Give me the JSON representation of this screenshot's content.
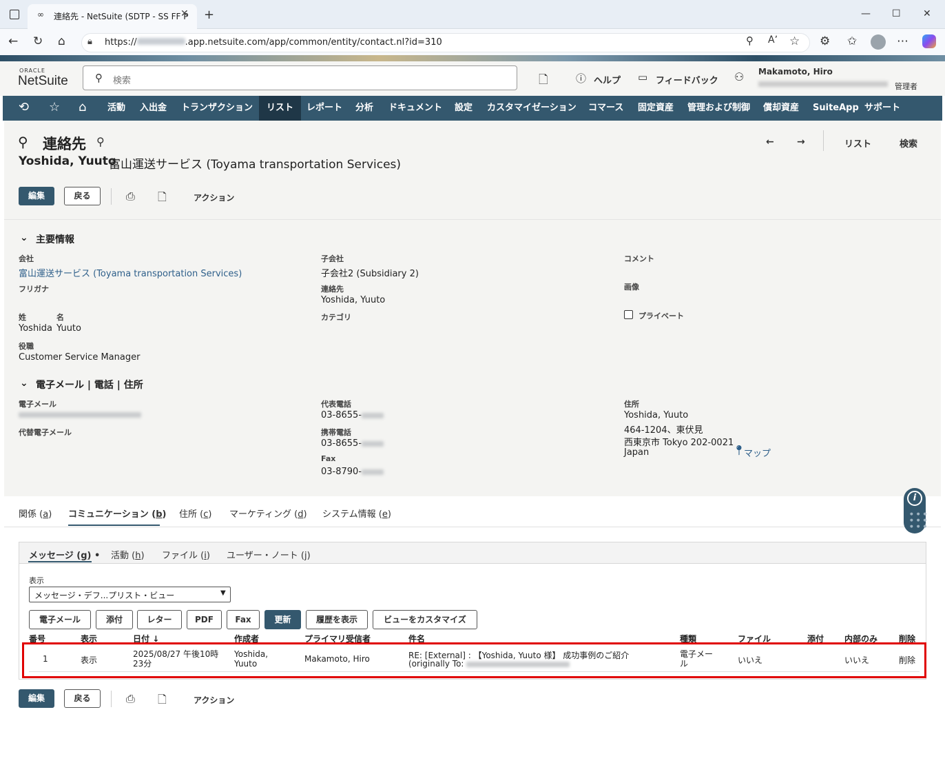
{
  "browser": {
    "tab_title": "連絡先 - NetSuite (SDTP - SS FF P",
    "url_prefix": "https://",
    "url_rest": ".app.netsuite.com/app/common/entity/contact.nl?id=310",
    "icons": [
      "back-icon",
      "reload-icon",
      "home-icon",
      "lock-icon",
      "zoom-icon",
      "read-aloud-icon",
      "favorite-icon",
      "extensions-icon",
      "favorites-icon",
      "profile-icon",
      "more-icon",
      "copilot-icon"
    ]
  },
  "header": {
    "logo_top": "ORACLE",
    "logo": "NetSuite",
    "search_placeholder": "検索",
    "help": "ヘルプ",
    "feedback": "フィードバック",
    "user_name": "Makamoto, Hiro",
    "user_role": "管理者"
  },
  "nav": {
    "items": [
      "活動",
      "入出金",
      "トランザクション",
      "リスト",
      "レポート",
      "分析",
      "ドキュメント",
      "設定",
      "カスタマイゼーション",
      "コマース",
      "固定資産",
      "管理および制御",
      "償却資産",
      "SuiteApp",
      "サポート"
    ],
    "active": "リスト"
  },
  "record": {
    "type": "連絡先",
    "name": "Yoshida, Yuuto",
    "company": "富山運送サービス (Toyama transportation Services)",
    "nav_list": "リスト",
    "nav_search": "検索"
  },
  "buttons": {
    "edit": "編集",
    "back": "戻る",
    "action": "アクション"
  },
  "primary": {
    "section_title": "主要情報",
    "company_label": "会社",
    "company_value": "富山運送サービス (Toyama transportation Services)",
    "furigana_label": "フリガナ",
    "last_label": "姓",
    "last_value": "Yoshida",
    "first_label": "名",
    "first_value": "Yuuto",
    "title_label": "役職",
    "title_value": "Customer Service Manager",
    "subsidiary_label": "子会社",
    "subsidiary_value": "子会社2 (Subsidiary 2)",
    "contact_label": "連絡先",
    "contact_value": "Yoshida, Yuuto",
    "category_label": "カテゴリ",
    "comment_label": "コメント",
    "image_label": "画像",
    "private_label": "プライベート"
  },
  "contact_info": {
    "section_title": "電子メール | 電話 | 住所",
    "email_label": "電子メール",
    "alt_email_label": "代替電子メール",
    "phone_label": "代表電話",
    "phone_value": "03-8655-",
    "mobile_label": "携帯電話",
    "mobile_value": "03-8655-",
    "fax_label": "Fax",
    "fax_value": "03-8790-",
    "address_label": "住所",
    "address_lines": [
      "Yoshida, Yuuto",
      "464-1204、東伏見",
      "西東京市 Tokyo 202-0021",
      "Japan"
    ],
    "map": "マップ"
  },
  "subtabs": [
    {
      "label": "関係",
      "key": "a"
    },
    {
      "label": "コミュニケーション",
      "key": "b"
    },
    {
      "label": "住所",
      "key": "c"
    },
    {
      "label": "マーケティング",
      "key": "d"
    },
    {
      "label": "システム情報",
      "key": "e"
    }
  ],
  "inner_tabs": [
    {
      "label": "メッセージ",
      "key": "g"
    },
    {
      "label": "活動",
      "key": "h"
    },
    {
      "label": "ファイル",
      "key": "i"
    },
    {
      "label": "ユーザー・ノート",
      "key": "j"
    }
  ],
  "messages": {
    "view_label": "表示",
    "view_value": "メッセージ・デフ...プリスト・ビュー",
    "buttons": [
      "電子メール",
      "添付",
      "レター",
      "PDF",
      "Fax",
      "更新",
      "履歴を表示",
      "ビューをカスタマイズ"
    ],
    "columns": [
      "番号",
      "表示",
      "日付",
      "作成者",
      "プライマリ受信者",
      "件名",
      "種類",
      "ファイル",
      "添付",
      "内部のみ",
      "削除"
    ],
    "row": {
      "num": "1",
      "view": "表示",
      "date": "2025/08/27 午後10時23分",
      "author": "Yoshida, Yuuto",
      "recipient": "Makamoto, Hiro",
      "subject": "RE: [External] : 【Yoshida, Yuuto 様】 成功事例のご紹介",
      "subject2": "(originally To:",
      "kind": "電子メール",
      "file": "いいえ",
      "internal": "いいえ",
      "delete": "削除"
    }
  }
}
